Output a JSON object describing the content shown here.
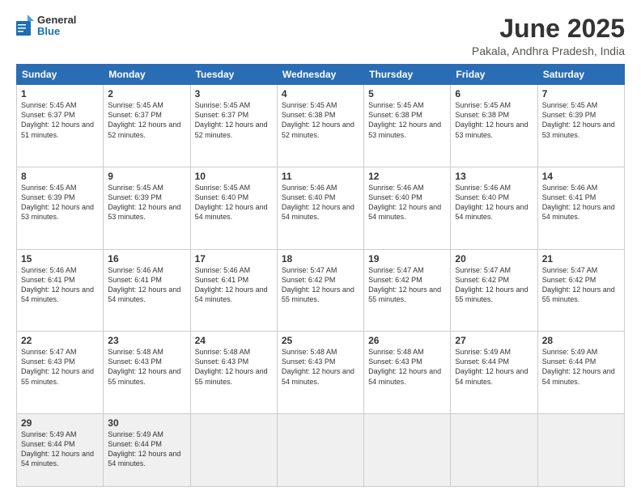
{
  "logo": {
    "line1": "General",
    "line2": "Blue"
  },
  "title": "June 2025",
  "subtitle": "Pakala, Andhra Pradesh, India",
  "headers": [
    "Sunday",
    "Monday",
    "Tuesday",
    "Wednesday",
    "Thursday",
    "Friday",
    "Saturday"
  ],
  "weeks": [
    [
      {
        "day": "1",
        "sunrise": "5:45 AM",
        "sunset": "6:37 PM",
        "daylight": "12 hours and 51 minutes."
      },
      {
        "day": "2",
        "sunrise": "5:45 AM",
        "sunset": "6:37 PM",
        "daylight": "12 hours and 52 minutes."
      },
      {
        "day": "3",
        "sunrise": "5:45 AM",
        "sunset": "6:37 PM",
        "daylight": "12 hours and 52 minutes."
      },
      {
        "day": "4",
        "sunrise": "5:45 AM",
        "sunset": "6:38 PM",
        "daylight": "12 hours and 52 minutes."
      },
      {
        "day": "5",
        "sunrise": "5:45 AM",
        "sunset": "6:38 PM",
        "daylight": "12 hours and 53 minutes."
      },
      {
        "day": "6",
        "sunrise": "5:45 AM",
        "sunset": "6:38 PM",
        "daylight": "12 hours and 53 minutes."
      },
      {
        "day": "7",
        "sunrise": "5:45 AM",
        "sunset": "6:39 PM",
        "daylight": "12 hours and 53 minutes."
      }
    ],
    [
      {
        "day": "8",
        "sunrise": "5:45 AM",
        "sunset": "6:39 PM",
        "daylight": "12 hours and 53 minutes."
      },
      {
        "day": "9",
        "sunrise": "5:45 AM",
        "sunset": "6:39 PM",
        "daylight": "12 hours and 53 minutes."
      },
      {
        "day": "10",
        "sunrise": "5:45 AM",
        "sunset": "6:40 PM",
        "daylight": "12 hours and 54 minutes."
      },
      {
        "day": "11",
        "sunrise": "5:46 AM",
        "sunset": "6:40 PM",
        "daylight": "12 hours and 54 minutes."
      },
      {
        "day": "12",
        "sunrise": "5:46 AM",
        "sunset": "6:40 PM",
        "daylight": "12 hours and 54 minutes."
      },
      {
        "day": "13",
        "sunrise": "5:46 AM",
        "sunset": "6:40 PM",
        "daylight": "12 hours and 54 minutes."
      },
      {
        "day": "14",
        "sunrise": "5:46 AM",
        "sunset": "6:41 PM",
        "daylight": "12 hours and 54 minutes."
      }
    ],
    [
      {
        "day": "15",
        "sunrise": "5:46 AM",
        "sunset": "6:41 PM",
        "daylight": "12 hours and 54 minutes."
      },
      {
        "day": "16",
        "sunrise": "5:46 AM",
        "sunset": "6:41 PM",
        "daylight": "12 hours and 54 minutes."
      },
      {
        "day": "17",
        "sunrise": "5:46 AM",
        "sunset": "6:41 PM",
        "daylight": "12 hours and 54 minutes."
      },
      {
        "day": "18",
        "sunrise": "5:47 AM",
        "sunset": "6:42 PM",
        "daylight": "12 hours and 55 minutes."
      },
      {
        "day": "19",
        "sunrise": "5:47 AM",
        "sunset": "6:42 PM",
        "daylight": "12 hours and 55 minutes."
      },
      {
        "day": "20",
        "sunrise": "5:47 AM",
        "sunset": "6:42 PM",
        "daylight": "12 hours and 55 minutes."
      },
      {
        "day": "21",
        "sunrise": "5:47 AM",
        "sunset": "6:42 PM",
        "daylight": "12 hours and 55 minutes."
      }
    ],
    [
      {
        "day": "22",
        "sunrise": "5:47 AM",
        "sunset": "6:43 PM",
        "daylight": "12 hours and 55 minutes."
      },
      {
        "day": "23",
        "sunrise": "5:48 AM",
        "sunset": "6:43 PM",
        "daylight": "12 hours and 55 minutes."
      },
      {
        "day": "24",
        "sunrise": "5:48 AM",
        "sunset": "6:43 PM",
        "daylight": "12 hours and 55 minutes."
      },
      {
        "day": "25",
        "sunrise": "5:48 AM",
        "sunset": "6:43 PM",
        "daylight": "12 hours and 54 minutes."
      },
      {
        "day": "26",
        "sunrise": "5:48 AM",
        "sunset": "6:43 PM",
        "daylight": "12 hours and 54 minutes."
      },
      {
        "day": "27",
        "sunrise": "5:49 AM",
        "sunset": "6:44 PM",
        "daylight": "12 hours and 54 minutes."
      },
      {
        "day": "28",
        "sunrise": "5:49 AM",
        "sunset": "6:44 PM",
        "daylight": "12 hours and 54 minutes."
      }
    ],
    [
      {
        "day": "29",
        "sunrise": "5:49 AM",
        "sunset": "6:44 PM",
        "daylight": "12 hours and 54 minutes."
      },
      {
        "day": "30",
        "sunrise": "5:49 AM",
        "sunset": "6:44 PM",
        "daylight": "12 hours and 54 minutes."
      },
      null,
      null,
      null,
      null,
      null
    ]
  ],
  "labels": {
    "sunrise": "Sunrise:",
    "sunset": "Sunset:",
    "daylight": "Daylight:"
  }
}
